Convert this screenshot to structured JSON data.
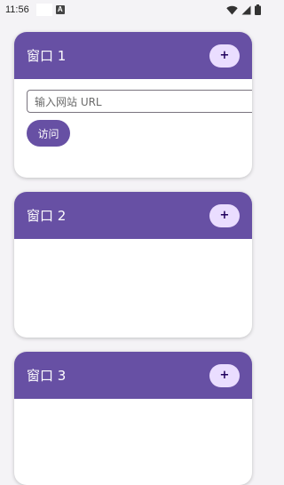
{
  "status_bar": {
    "time": "11:56",
    "badge_letter": "A"
  },
  "windows": [
    {
      "title": "窗口 1",
      "add_label": "+",
      "url_placeholder": "输入网站 URL",
      "visit_label": "访问"
    },
    {
      "title": "窗口 2",
      "add_label": "+"
    },
    {
      "title": "窗口 3",
      "add_label": "+"
    }
  ],
  "colors": {
    "header": "#6750a4",
    "add_button": "#eaddff",
    "background": "#f4f3f6"
  }
}
